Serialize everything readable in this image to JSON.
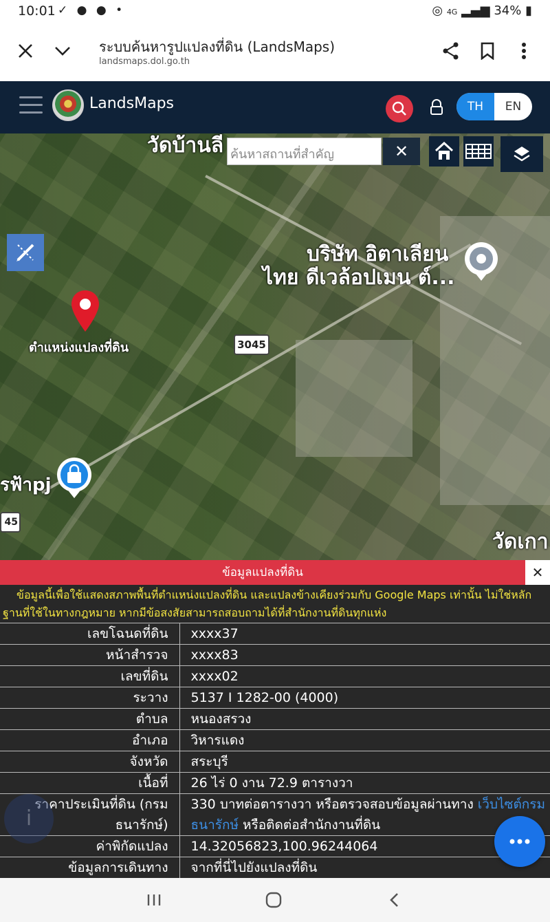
{
  "status": {
    "time": "10:01",
    "notifications": "✓ ● ● •",
    "battery": "34%",
    "network": "4G"
  },
  "browser": {
    "title": "ระบบค้นหารูปแปลงที่ดิน (LandsMaps)",
    "url": "landsmaps.dol.go.th"
  },
  "app": {
    "brand": "LandsMaps",
    "lang_th": "TH",
    "lang_en": "EN"
  },
  "map": {
    "search_placeholder": "ค้นหาสถานที่สำคัญ",
    "pin_label": "ตำแหน่งแปลงที่ดิน",
    "labels": {
      "temple_top": "วัดบ้านลี",
      "company_line1": "บริษัท อิตาเลียน",
      "company_line2": "ไทย ดีเวล้อปเมน ต์...",
      "shop": "รฟ้าpj",
      "temple_bottom": "วัดเกา"
    },
    "route_number": "3045",
    "route_number_partial": "45"
  },
  "panel": {
    "header": "ข้อมูลแปลงที่ดิน",
    "note_line1": "ข้อมูลนี้เพื่อใช้แสดงสภาพพื้นที่ตำแหน่งแปลงที่ดิน และแปลงข้างเคียงร่วมกับ Google Maps เท่านั้น ไม่ใช่หลัก",
    "note_line2": "ฐานที่ใช้ในทางกฎหมาย หากมีข้อสงสัยสามารถสอบถามได้ที่สำนักงานที่ดินทุกแห่ง",
    "rows": {
      "deed_no": {
        "label": "เลขโฉนดที่ดิน",
        "value": "xxxx37"
      },
      "survey_page": {
        "label": "หน้าสำรวจ",
        "value": "xxxx83"
      },
      "land_no": {
        "label": "เลขที่ดิน",
        "value": "xxxx02"
      },
      "map_sheet": {
        "label": "ระวาง",
        "value": "5137 I 1282-00 (4000)"
      },
      "subdistrict": {
        "label": "ตำบล",
        "value": "หนองสรวง"
      },
      "district": {
        "label": "อำเภอ",
        "value": "วิหารแดง"
      },
      "province": {
        "label": "จังหวัด",
        "value": "สระบุรี"
      },
      "area": {
        "label": "เนื้อที่",
        "value": "26 ไร่ 0 งาน 72.9 ตารางวา"
      },
      "appraisal": {
        "label_line1": "ราคาประเมินที่ดิน (กรม",
        "label_line2": "ธนารักษ์)",
        "value_text1": "330 บาทต่อตารางวา หรือตรวจสอบข้อมูลผ่านทาง ",
        "value_link1": "เว็บไซต์กรม",
        "value_link2": "ธนารักษ์",
        "value_text2": " หรือติดต่อสำนักงานที่ดิน"
      },
      "coordinates": {
        "label": "ค่าพิกัดแปลง",
        "value": "14.32056823,100.96244064"
      },
      "directions": {
        "label": "ข้อมูลการเดินทาง",
        "value": "จากที่นี่ไปยังแปลงที่ดิน"
      }
    }
  },
  "colors": {
    "appbar": "#0f2238",
    "accent_red": "#dc3545",
    "accent_blue": "#1e88e5",
    "note_yellow": "#f5e642",
    "link_blue": "#3d8fe5"
  }
}
